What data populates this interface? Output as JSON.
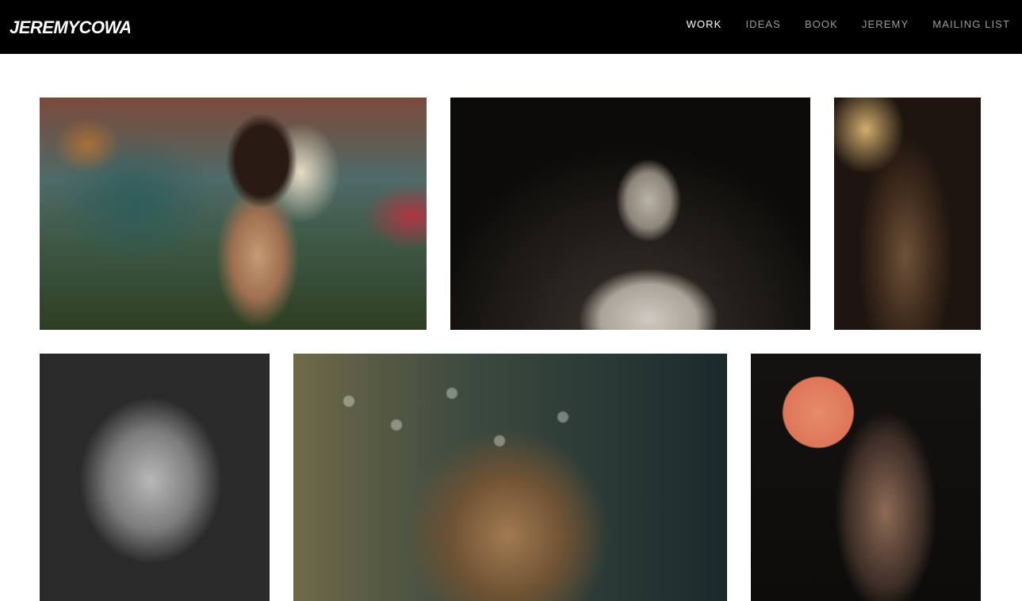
{
  "header": {
    "logo_text": "JEREMYCOWART",
    "nav": [
      {
        "label": "WORK",
        "active": true
      },
      {
        "label": "IDEAS",
        "active": false
      },
      {
        "label": "BOOK",
        "active": false
      },
      {
        "label": "JEREMY",
        "active": false
      },
      {
        "label": "MAILING LIST",
        "active": false
      }
    ]
  },
  "gallery": {
    "tiles": [
      {
        "subject": "woman with colorful textured background"
      },
      {
        "subject": "man in profile under glass dome"
      },
      {
        "subject": "woman with braids in warm light"
      },
      {
        "subject": "black and white portrait with lace shadow"
      },
      {
        "subject": "face behind water with bubbles"
      },
      {
        "subject": "woman with orange sphere"
      }
    ]
  },
  "colors": {
    "header_bg": "#000000",
    "nav_active": "#ffffff",
    "nav_inactive": "#9a9a9a",
    "page_bg": "#ffffff"
  }
}
